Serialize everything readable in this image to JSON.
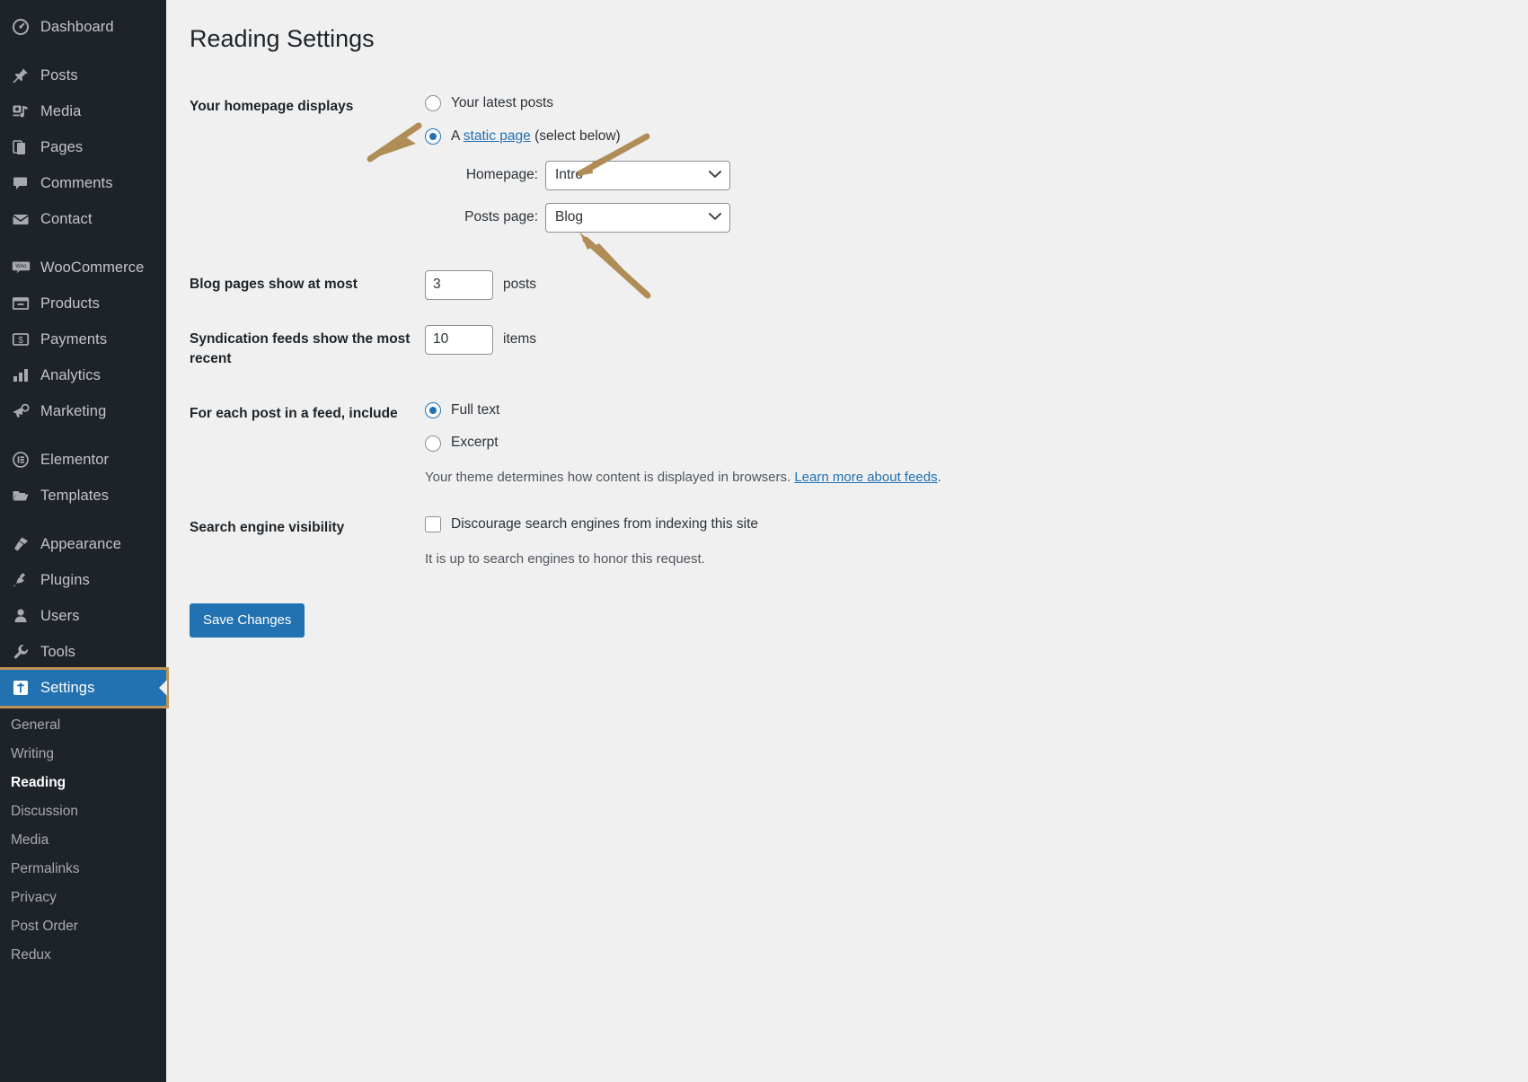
{
  "sidebar": {
    "items": [
      {
        "label": "Dashboard",
        "icon": "dashboard-icon"
      },
      {
        "label": "Posts",
        "icon": "pin-icon"
      },
      {
        "label": "Media",
        "icon": "media-icon"
      },
      {
        "label": "Pages",
        "icon": "pages-icon"
      },
      {
        "label": "Comments",
        "icon": "comments-icon"
      },
      {
        "label": "Contact",
        "icon": "envelope-icon"
      },
      {
        "label": "WooCommerce",
        "icon": "woocommerce-icon"
      },
      {
        "label": "Products",
        "icon": "products-icon"
      },
      {
        "label": "Payments",
        "icon": "payments-icon"
      },
      {
        "label": "Analytics",
        "icon": "analytics-icon"
      },
      {
        "label": "Marketing",
        "icon": "megaphone-icon"
      },
      {
        "label": "Elementor",
        "icon": "elementor-icon"
      },
      {
        "label": "Templates",
        "icon": "folder-icon"
      },
      {
        "label": "Appearance",
        "icon": "brush-icon"
      },
      {
        "label": "Plugins",
        "icon": "plug-icon"
      },
      {
        "label": "Users",
        "icon": "user-icon"
      },
      {
        "label": "Tools",
        "icon": "wrench-icon"
      },
      {
        "label": "Settings",
        "icon": "settings-icon"
      }
    ],
    "submenu": [
      {
        "label": "General"
      },
      {
        "label": "Writing"
      },
      {
        "label": "Reading"
      },
      {
        "label": "Discussion"
      },
      {
        "label": "Media"
      },
      {
        "label": "Permalinks"
      },
      {
        "label": "Privacy"
      },
      {
        "label": "Post Order"
      },
      {
        "label": "Redux"
      }
    ],
    "active_submenu": "Reading",
    "highlight_color": "#bf9355",
    "current_color": "#2271b1"
  },
  "page": {
    "title": "Reading Settings"
  },
  "homepage_displays": {
    "label": "Your homepage displays",
    "option_latest": "Your latest posts",
    "option_static_prefix": "A ",
    "option_static_link": "static page",
    "option_static_suffix": " (select below)",
    "selected": "static",
    "homepage_caption": "Homepage:",
    "homepage_value": "Intro",
    "posts_page_caption": "Posts page:",
    "posts_page_value": "Blog"
  },
  "blog_pages": {
    "label": "Blog pages show at most",
    "value": "3",
    "unit": "posts"
  },
  "syndication": {
    "label": "Syndication feeds show the most recent",
    "value": "10",
    "unit": "items"
  },
  "feed_include": {
    "label": "For each post in a feed, include",
    "option_full": "Full text",
    "option_excerpt": "Excerpt",
    "selected": "full",
    "description_text": "Your theme determines how content is displayed in browsers. ",
    "description_link": "Learn more about feeds",
    "description_end": "."
  },
  "search_visibility": {
    "label": "Search engine visibility",
    "checkbox_label": "Discourage search engines from indexing this site",
    "checked": false,
    "note": "It is up to search engines to honor this request."
  },
  "actions": {
    "save_label": "Save Changes"
  },
  "annotations": {
    "arrow_color": "#b08d57",
    "count": 3
  }
}
